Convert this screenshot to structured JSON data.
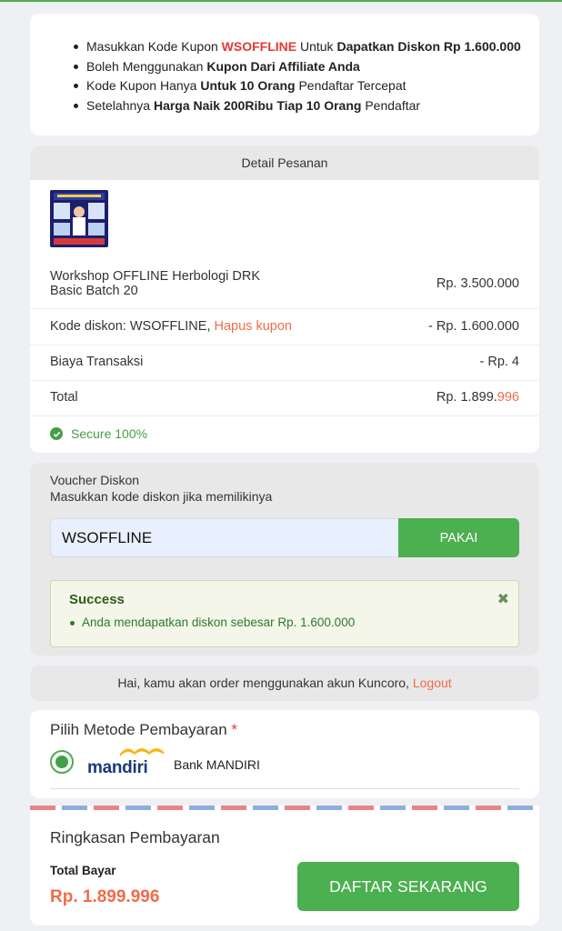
{
  "promo": {
    "lines": [
      {
        "a": "Masukkan Kode Kupon ",
        "b": "WSOFFLINE",
        "c": " Untuk ",
        "d": "Dapatkan Diskon Rp 1.600.000"
      },
      {
        "a": "Boleh Menggunakan ",
        "b": "Kupon Dari Affiliate Anda"
      },
      {
        "a": "Kode Kupon Hanya ",
        "b": "Untuk 10 Orang",
        "c": " Pendaftar Tercepat"
      },
      {
        "a": "Setelahnya ",
        "b": "Harga Naik 200Ribu Tiap 10 Orang",
        "c": " Pendaftar"
      }
    ]
  },
  "order": {
    "header": "Detail Pesanan",
    "product_line1": "Workshop OFFLINE Herbologi DRK",
    "product_line2": "Basic Batch 20",
    "product_price": "Rp. 3.500.000",
    "discount_label": "Kode diskon: WSOFFLINE, ",
    "remove_coupon": "Hapus kupon",
    "discount_value": "- Rp. 1.600.000",
    "fee_label": "Biaya Transaksi",
    "fee_value": "- Rp. 4",
    "total_label": "Total",
    "total_main": "Rp. 1.899.",
    "total_unique": "996",
    "secure": "Secure 100%"
  },
  "voucher": {
    "title": "Voucher Diskon",
    "subtitle": "Masukkan kode diskon jika memilikinya",
    "input_value": "WSOFFLINE",
    "apply_label": "PAKAI",
    "alert_title": "Success",
    "alert_close": "✖",
    "alert_message": "Anda mendapatkan diskon sebesar Rp. 1.600.000"
  },
  "account": {
    "text": "Hai, kamu akan order menggunakan akun Kuncoro, ",
    "logout": "Logout"
  },
  "payment": {
    "title": "Pilih Metode Pembayaran",
    "required_mark": "*",
    "logo_text": "mandiri",
    "bank_name": "Bank MANDIRI"
  },
  "summary": {
    "title": "Ringkasan Pembayaran",
    "total_label": "Total Bayar",
    "total_value": "Rp. 1.899.996",
    "cta": "DAFTAR SEKARANG"
  },
  "colors": {
    "accent_green": "#4caf50",
    "price_orange": "#f06c4a",
    "coupon_red": "#e53935"
  }
}
